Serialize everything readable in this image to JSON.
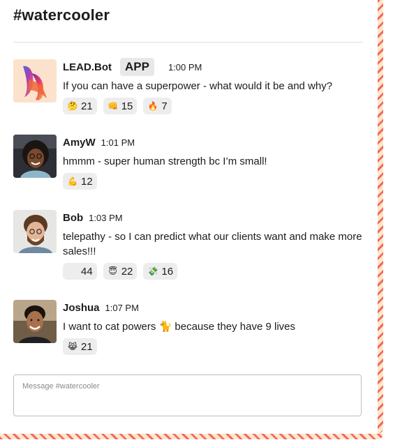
{
  "channel": {
    "title": "#watercooler"
  },
  "composer": {
    "placeholder": "Message #watercooler"
  },
  "messages": [
    {
      "author": "LEAD.Bot",
      "badge": "APP",
      "time": "1:00 PM",
      "text": "If you can have a superpower - what would it be and why?",
      "avatar_icon": "lead-bot-logo-icon",
      "reactions": [
        {
          "emoji": "🤔",
          "icon": "thinking-face-icon",
          "count": "21"
        },
        {
          "emoji": "👊",
          "icon": "fist-bump-icon",
          "count": "15"
        },
        {
          "emoji": "🔥",
          "icon": "fire-icon",
          "count": "7"
        }
      ]
    },
    {
      "author": "AmyW",
      "time": "1:01 PM",
      "text": "hmmm - super human strength bc I’m small!",
      "avatar_icon": "user-avatar",
      "reactions": [
        {
          "emoji": "💪",
          "icon": "flexed-biceps-icon",
          "count": "12"
        }
      ]
    },
    {
      "author": "Bob",
      "time": "1:03 PM",
      "text": "telepathy - so I can predict what our clients want and make more sales!!!",
      "avatar_icon": "user-avatar",
      "reactions": [
        {
          "emoji": "",
          "icon": "blank-emoji-icon",
          "count": "44"
        },
        {
          "emoji": "😇",
          "icon": "smiling-halo-icon",
          "count": "22"
        },
        {
          "emoji": "💸",
          "icon": "money-wings-icon",
          "count": "16"
        }
      ]
    },
    {
      "author": "Joshua",
      "time": "1:07 PM",
      "text": "I want to cat powers 🐈 because they have 9 lives",
      "avatar_icon": "user-avatar",
      "reactions": [
        {
          "emoji": "😹",
          "icon": "cat-tears-of-joy-icon",
          "count": "21"
        }
      ]
    }
  ],
  "colors": {
    "stripe": "#f26b5b",
    "stripe_bg": "#fde7cf",
    "reaction_bg": "#ededed"
  }
}
